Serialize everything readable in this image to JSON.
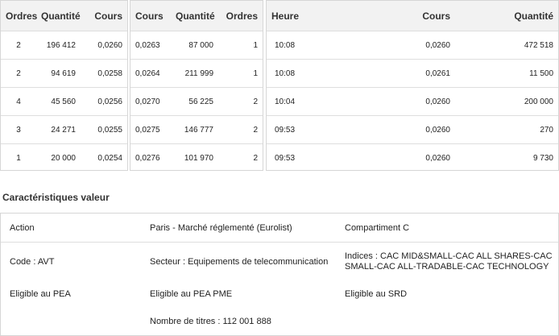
{
  "bids": {
    "headers": [
      "Ordres",
      "Quantité",
      "Cours"
    ],
    "rows": [
      [
        "2",
        "196 412",
        "0,0260"
      ],
      [
        "2",
        "94 619",
        "0,0258"
      ],
      [
        "4",
        "45 560",
        "0,0256"
      ],
      [
        "3",
        "24 271",
        "0,0255"
      ],
      [
        "1",
        "20 000",
        "0,0254"
      ]
    ]
  },
  "asks": {
    "headers": [
      "Cours",
      "Quantité",
      "Ordres"
    ],
    "rows": [
      [
        "0,0263",
        "87 000",
        "1"
      ],
      [
        "0,0264",
        "211 999",
        "1"
      ],
      [
        "0,0270",
        "56 225",
        "2"
      ],
      [
        "0,0275",
        "146 777",
        "2"
      ],
      [
        "0,0276",
        "101 970",
        "2"
      ]
    ]
  },
  "trades": {
    "headers": [
      "Heure",
      "Cours",
      "Quantité"
    ],
    "rows": [
      [
        "10:08",
        "0,0260",
        "472 518"
      ],
      [
        "10:08",
        "0,0261",
        "11 500"
      ],
      [
        "10:04",
        "0,0260",
        "200 000"
      ],
      [
        "09:53",
        "0,0260",
        "270"
      ],
      [
        "09:53",
        "0,0260",
        "9 730"
      ]
    ]
  },
  "characteristics": {
    "title": "Caractéristiques valeur",
    "type": "Action",
    "market": "Paris - Marché réglementé (Eurolist)",
    "compartment": "Compartiment C",
    "code": "Code : AVT",
    "sector": "Secteur : Equipements de telecommunication",
    "indices_line1": "Indices : CAC MID&SMALL-CAC ALL SHARES-CAC",
    "indices_line2": "SMALL-CAC ALL-TRADABLE-CAC TECHNOLOGY",
    "pea": "Eligible au PEA",
    "pea_pme": "Eligible au PEA PME",
    "srd": "Eligible au SRD",
    "shares_count": "Nombre de titres : 112 001 888"
  }
}
